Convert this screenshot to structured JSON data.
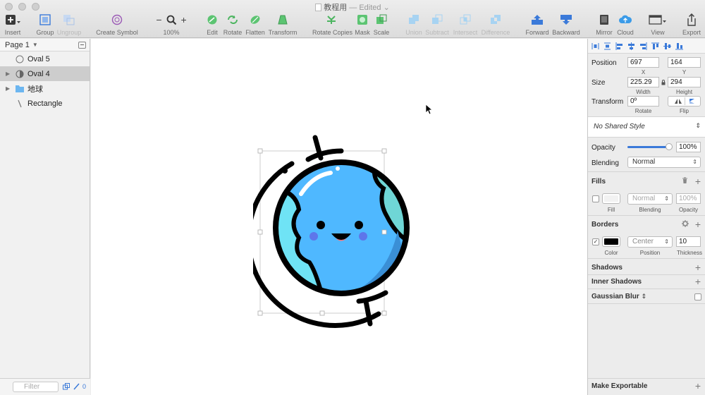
{
  "window": {
    "title": "教程用",
    "edited": "— Edited"
  },
  "toolbar": {
    "insert": "Insert",
    "group": "Group",
    "ungroup": "Ungroup",
    "create_symbol": "Create Symbol",
    "zoom": "100%",
    "edit": "Edit",
    "rotate": "Rotate",
    "flatten": "Flatten",
    "transform": "Transform",
    "rotate_copies": "Rotate Copies",
    "mask": "Mask",
    "scale": "Scale",
    "union": "Union",
    "subtract": "Subtract",
    "intersect": "Intersect",
    "difference": "Difference",
    "forward": "Forward",
    "backward": "Backward",
    "mirror": "Mirror",
    "cloud": "Cloud",
    "view": "View",
    "export": "Export"
  },
  "layers": {
    "page": "Page 1",
    "items": [
      {
        "name": "Oval 5",
        "icon": "oval-icon"
      },
      {
        "name": "Oval 4",
        "icon": "oval-half-icon",
        "selected": true
      },
      {
        "name": "地球",
        "icon": "folder-icon"
      },
      {
        "name": "Rectangle",
        "icon": "line-icon"
      }
    ],
    "filter_placeholder": "Filter",
    "symbol_count": "0"
  },
  "inspector": {
    "position_label": "Position",
    "x": "697",
    "y": "164",
    "x_label": "X",
    "y_label": "Y",
    "size_label": "Size",
    "width": "225.29",
    "height": "294",
    "width_label": "Width",
    "height_label": "Height",
    "transform_label": "Transform",
    "rotate": "0º",
    "rotate_label": "Rotate",
    "flip_label": "Flip",
    "shared_style": "No Shared Style",
    "opacity_label": "Opacity",
    "opacity_value": "100%",
    "opacity_level": 1.0,
    "blending_label": "Blending",
    "blending_value": "Normal",
    "fills_title": "Fills",
    "fill_label": "Fill",
    "fill_blending": "Normal",
    "fill_blending_label": "Blending",
    "fill_opacity": "100%",
    "fill_opacity_label": "Opacity",
    "borders_title": "Borders",
    "border_color_label": "Color",
    "border_position": "Center",
    "border_position_label": "Position",
    "border_thickness": "10",
    "border_thickness_label": "Thickness",
    "shadows_title": "Shadows",
    "inner_shadows_title": "Inner Shadows",
    "gaussian_blur_title": "Gaussian Blur",
    "make_exportable": "Make Exportable"
  },
  "colors": {
    "accent": "#3b7ad9",
    "globe_blue": "#4fb8ff",
    "land_cyan": "#6fe3f5",
    "border_black": "#000000"
  }
}
